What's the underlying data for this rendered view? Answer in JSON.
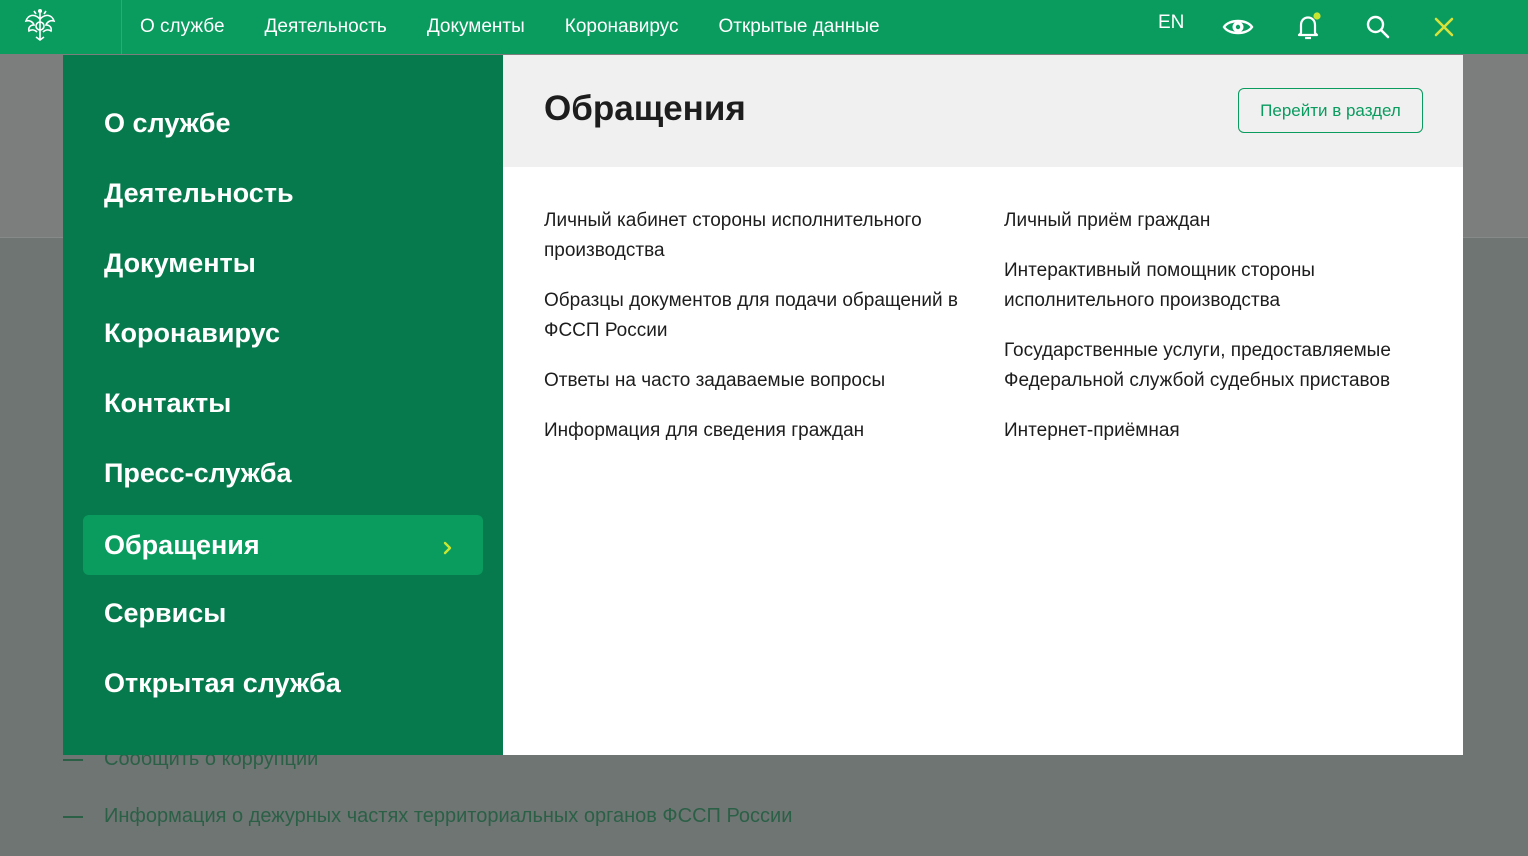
{
  "header": {
    "nav": [
      "О службе",
      "Деятельность",
      "Документы",
      "Коронавирус",
      "Открытые данные"
    ],
    "lang": "EN",
    "icons": {
      "logo": "coat-of-arms-icon",
      "accessibility": "eye-icon",
      "notifications": "bell-icon",
      "search": "search-icon",
      "close": "close-icon"
    }
  },
  "menu": {
    "items": [
      "О службе",
      "Деятельность",
      "Документы",
      "Коронавирус",
      "Контакты",
      "Пресс-служба",
      "Обращения",
      "Сервисы",
      "Открытая служба"
    ],
    "active_index": 6
  },
  "panel": {
    "title": "Обращения",
    "goto_label": "Перейти в раздел",
    "col1": [
      "Личный кабинет стороны исполнительного производства",
      "Образцы документов для подачи обращений в ФССП России",
      "Ответы на часто задаваемые вопросы",
      "Информация для сведения граждан"
    ],
    "col2": [
      "Личный приём граждан",
      "Интерактивный помощник стороны исполнительного производства",
      "Государственные услуги, предоставляемые Федеральной службой судебных приставов",
      "Интернет-приёмная"
    ]
  },
  "background": {
    "links": [
      "Сообщить о коррупции",
      "Информация о дежурных частях территориальных органов ФССП России"
    ]
  },
  "colors": {
    "header_green": "#0a9b5f",
    "menu_dark_green": "#067a4c",
    "notification_dot": "#c8e631",
    "close_yellow": "#d7e33a"
  }
}
